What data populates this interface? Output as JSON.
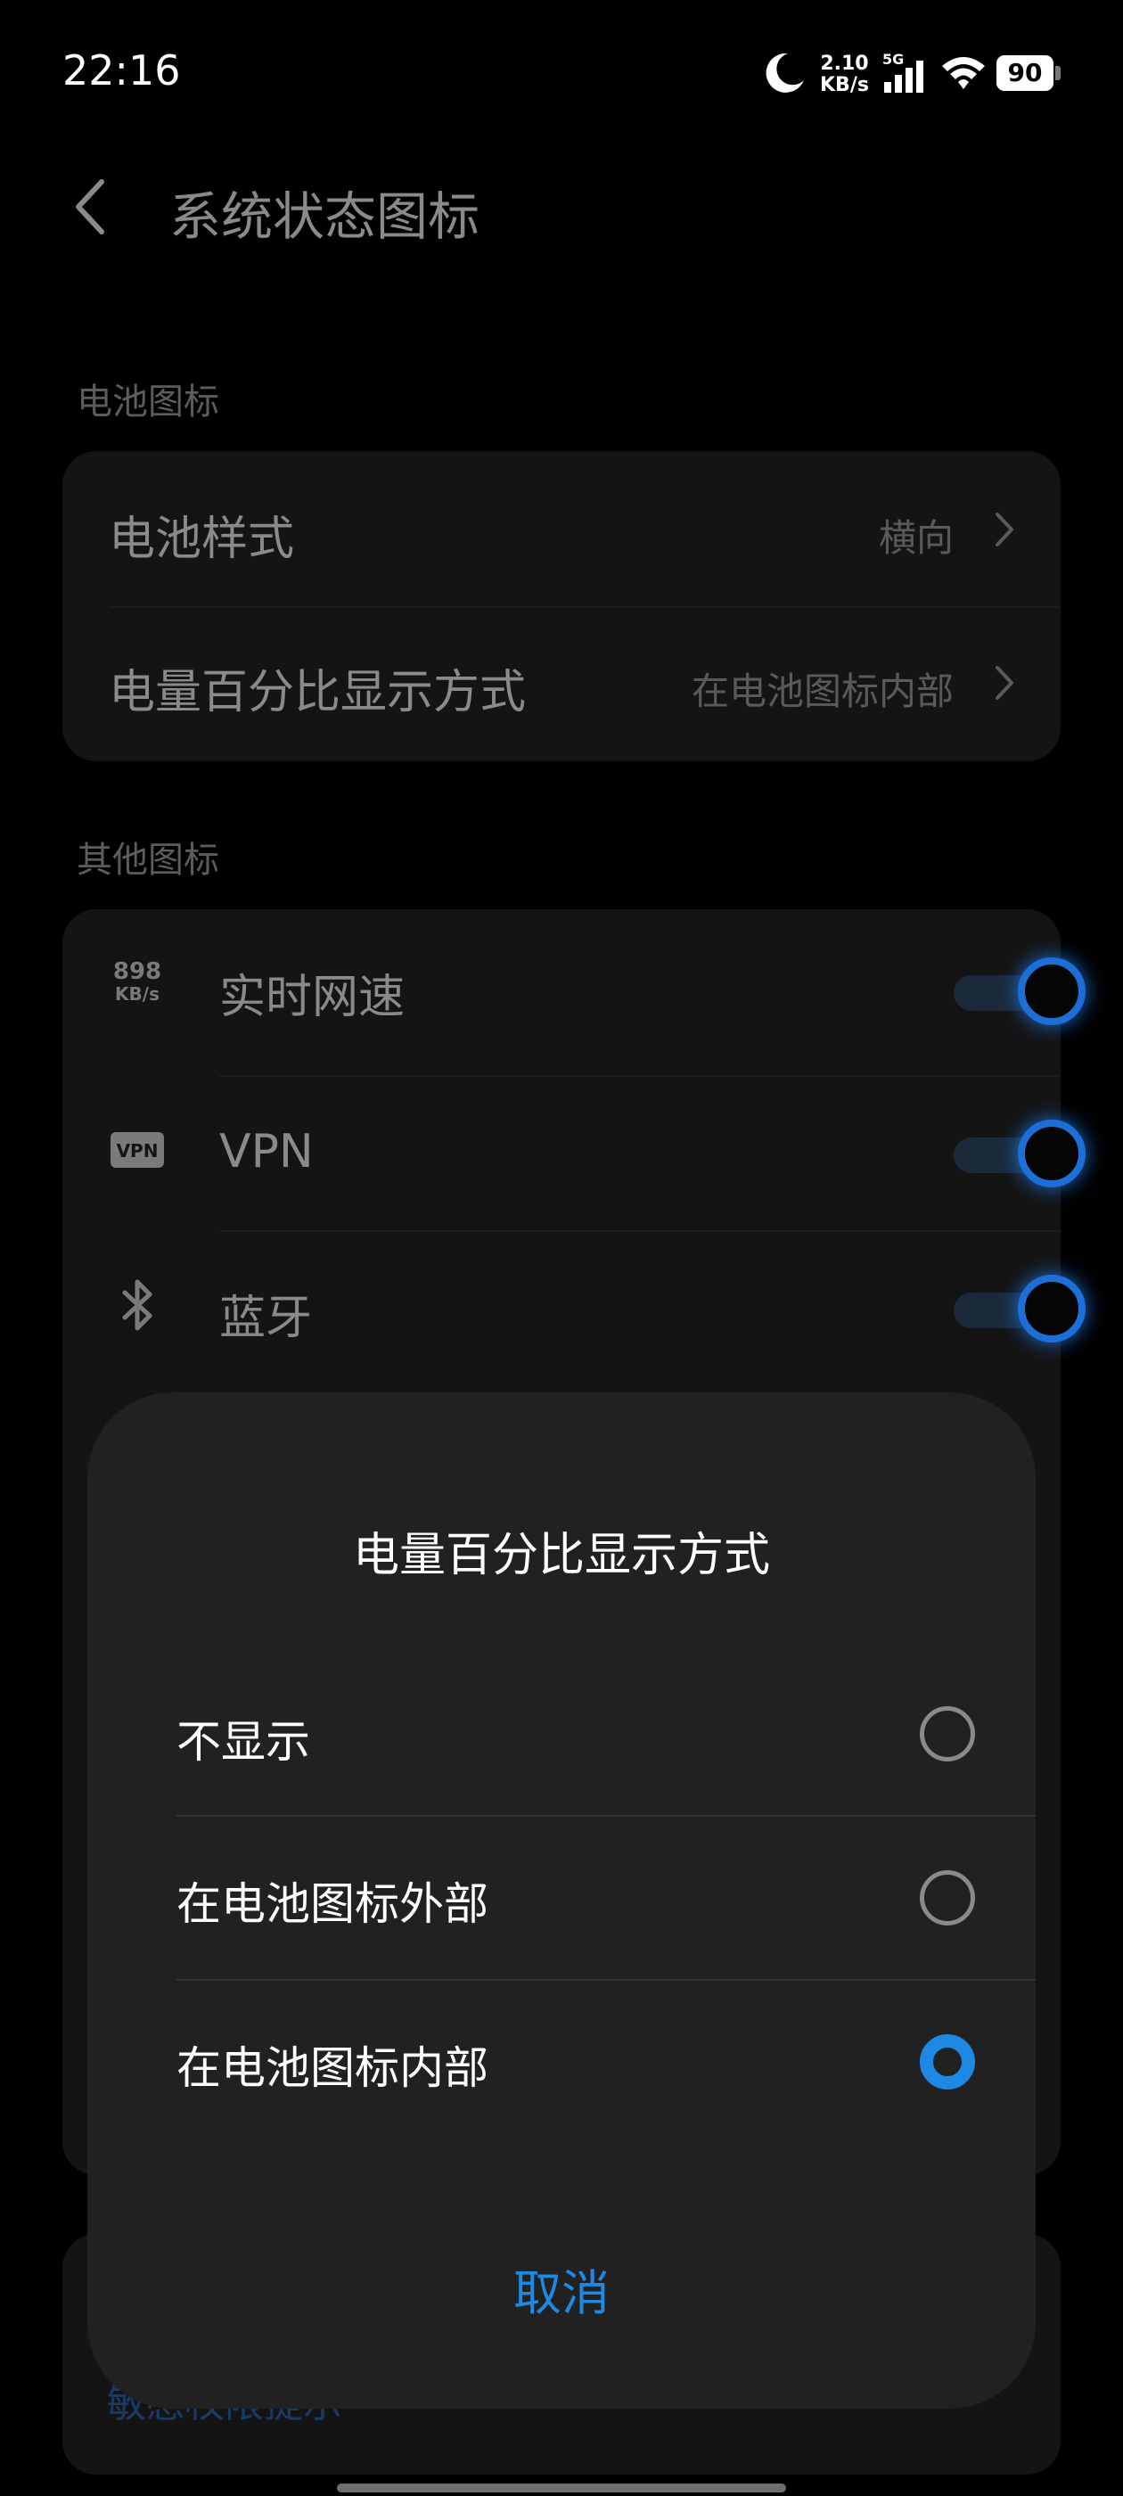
{
  "status": {
    "time": "22:16",
    "net_speed_value": "2.10",
    "net_speed_unit": "KB/s",
    "network_type": "5G",
    "battery_level": "90"
  },
  "header": {
    "title": "系统状态图标"
  },
  "sections": {
    "battery_icon": {
      "label": "电池图标",
      "items": [
        {
          "label": "电池样式",
          "value": "横向"
        },
        {
          "label": "电量百分比显示方式",
          "value": "在电池图标内部"
        }
      ]
    },
    "other_icons": {
      "label": "其他图标",
      "items": [
        {
          "label": "实时网速",
          "icon": "net-speed-icon",
          "icon_top": "898",
          "icon_bottom": "KB/s",
          "on": true
        },
        {
          "label": "VPN",
          "icon": "vpn-icon",
          "icon_text": "VPN",
          "on": true
        },
        {
          "label": "蓝牙",
          "icon": "bluetooth-icon",
          "on": true
        }
      ]
    }
  },
  "dialog": {
    "title": "电量百分比显示方式",
    "options": [
      {
        "label": "不显示",
        "selected": false
      },
      {
        "label": "在电池图标外部",
        "selected": false
      },
      {
        "label": "在电池图标内部",
        "selected": true
      }
    ],
    "cancel_label": "取消"
  },
  "obscured_link": "敏感权限提示",
  "colors": {
    "accent": "#1e88e5",
    "background": "#000000",
    "dialog": "#212121"
  }
}
